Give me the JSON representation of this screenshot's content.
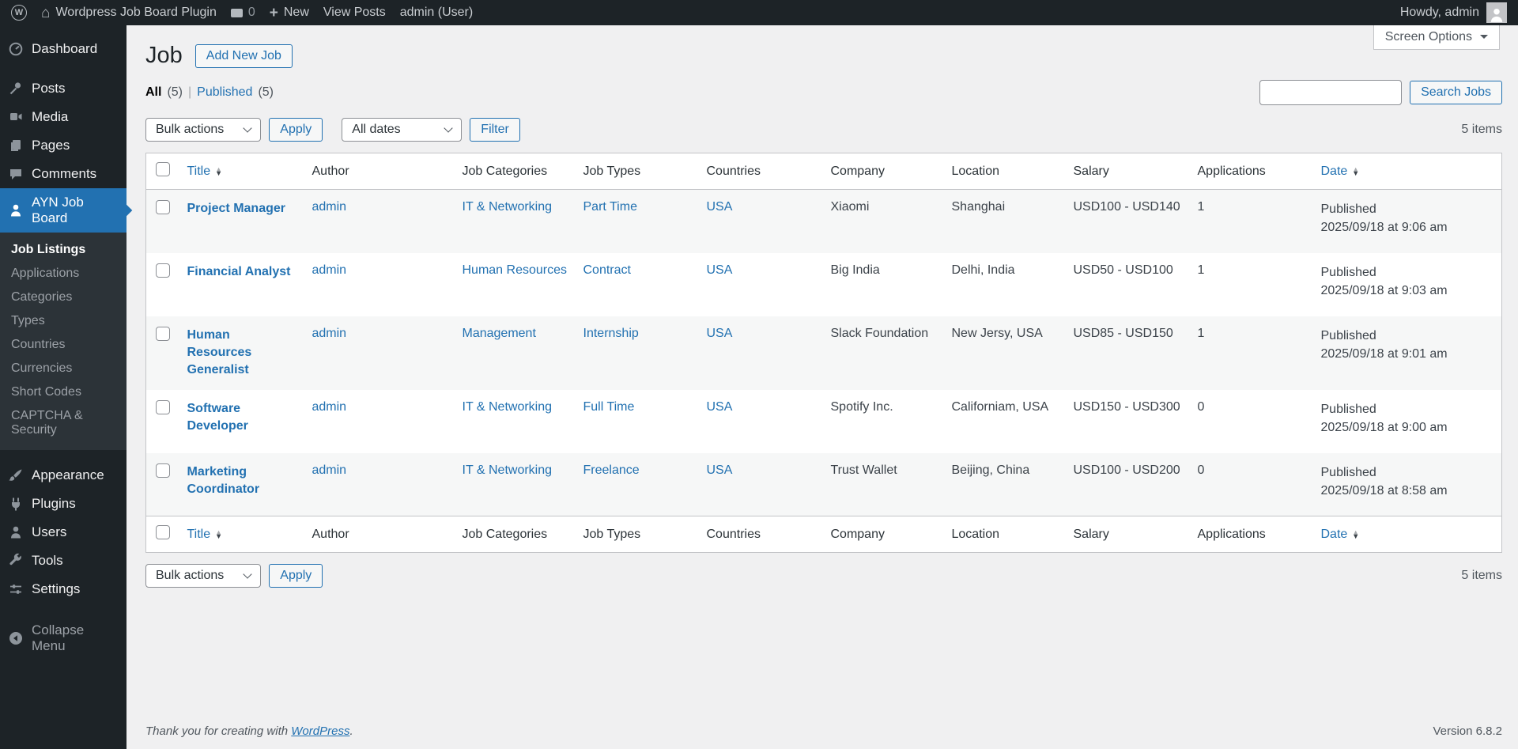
{
  "admin_bar": {
    "site_name": "Wordpress Job Board Plugin",
    "comment_count": "0",
    "new_label": "New",
    "view_posts_label": "View Posts",
    "admin_user_label": "admin (User)",
    "howdy": "Howdy, admin",
    "wp_logo_letter": "W"
  },
  "screen_options_label": "Screen Options",
  "sidebar": {
    "main": [
      {
        "label": "Dashboard"
      },
      {
        "label": "Posts"
      },
      {
        "label": "Media"
      },
      {
        "label": "Pages"
      },
      {
        "label": "Comments"
      },
      {
        "label": "AYN Job Board"
      },
      {
        "label": "Appearance"
      },
      {
        "label": "Plugins"
      },
      {
        "label": "Users"
      },
      {
        "label": "Tools"
      },
      {
        "label": "Settings"
      },
      {
        "label": "Collapse Menu"
      }
    ],
    "submenu": [
      {
        "label": "Job Listings",
        "current": true
      },
      {
        "label": "Applications"
      },
      {
        "label": "Categories"
      },
      {
        "label": "Types"
      },
      {
        "label": "Countries"
      },
      {
        "label": "Currencies"
      },
      {
        "label": "Short Codes"
      },
      {
        "label": "CAPTCHA & Security"
      }
    ]
  },
  "page": {
    "title": "Job",
    "add_new_label": "Add New Job",
    "view_all_label": "All",
    "view_all_count": "(5)",
    "view_published_label": "Published",
    "view_published_count": "(5)",
    "search_button_label": "Search Jobs",
    "bulk_actions_label": "Bulk actions",
    "apply_label": "Apply",
    "all_dates_label": "All dates",
    "filter_label": "Filter",
    "items_count_top": "5 items",
    "items_count_bottom": "5 items"
  },
  "table": {
    "columns": [
      "Title",
      "Author",
      "Job Categories",
      "Job Types",
      "Countries",
      "Company",
      "Location",
      "Salary",
      "Applications",
      "Date"
    ],
    "rows": [
      {
        "title": "Project Manager",
        "author": "admin",
        "category": "IT & Networking",
        "type": "Part Time",
        "country": "USA",
        "company": "Xiaomi",
        "location": "Shanghai",
        "salary": "USD100 - USD140",
        "applications": "1",
        "status": "Published",
        "date": "2025/09/18 at 9:06 am"
      },
      {
        "title": "Financial Analyst",
        "author": "admin",
        "category": "Human Resources",
        "type": "Contract",
        "country": "USA",
        "company": "Big India",
        "location": "Delhi, India",
        "salary": "USD50 - USD100",
        "applications": "1",
        "status": "Published",
        "date": "2025/09/18 at 9:03 am"
      },
      {
        "title": "Human Resources Generalist",
        "author": "admin",
        "category": "Management",
        "type": "Internship",
        "country": "USA",
        "company": "Slack Foundation",
        "location": "New Jersy, USA",
        "salary": "USD85 - USD150",
        "applications": "1",
        "status": "Published",
        "date": "2025/09/18 at 9:01 am"
      },
      {
        "title": "Software Developer",
        "author": "admin",
        "category": "IT & Networking",
        "type": "Full Time",
        "country": "USA",
        "company": "Spotify Inc.",
        "location": "Californiam, USA",
        "salary": "USD150 - USD300",
        "applications": "0",
        "status": "Published",
        "date": "2025/09/18 at 9:00 am"
      },
      {
        "title": "Marketing Coordinator",
        "author": "admin",
        "category": "IT & Networking",
        "type": "Freelance",
        "country": "USA",
        "company": "Trust Wallet",
        "location": "Beijing, China",
        "salary": "USD100 - USD200",
        "applications": "0",
        "status": "Published",
        "date": "2025/09/18 at 8:58 am"
      }
    ]
  },
  "footer": {
    "thanks_prefix": "Thank you for creating with ",
    "wordpress_link": "WordPress",
    "thanks_suffix": ".",
    "version": "Version 6.8.2"
  },
  "colors": {
    "accent_blue": "#2271b1",
    "admin_dark": "#1d2327",
    "submenu_dark": "#2c3338",
    "content_bg": "#f0f0f1",
    "table_border": "#c3c4c7",
    "stripe": "#f6f7f7"
  }
}
